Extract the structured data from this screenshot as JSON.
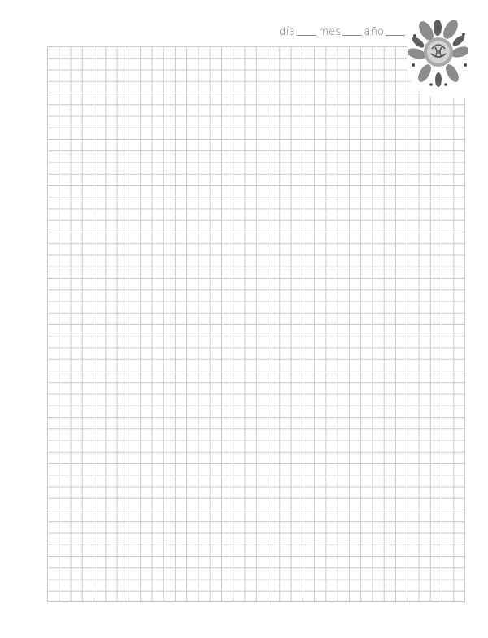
{
  "header": {
    "day_label": "día",
    "month_label": "mes",
    "year_label": "año"
  },
  "decoration": {
    "icon": "floral-ornament-icon",
    "grid_color": "#c9c9c9",
    "ink_color": "#6f6f6f"
  }
}
